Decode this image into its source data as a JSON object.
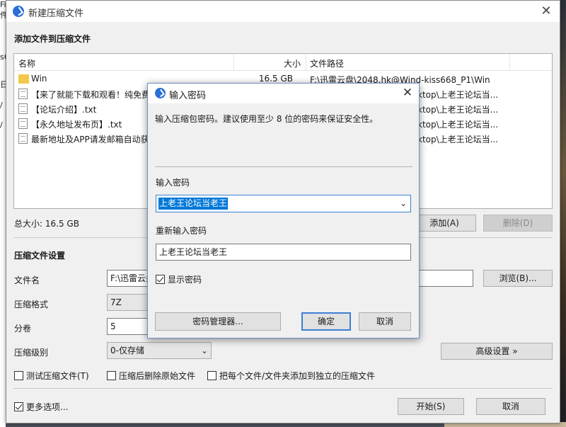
{
  "background": {
    "left_fragments": [
      "件",
      "Fi",
      "s6",
      "日",
      "/",
      "/"
    ]
  },
  "main_window": {
    "title": "新建压缩文件",
    "section_add": "添加文件到压缩文件",
    "columns": {
      "name": "名称",
      "size": "大小",
      "path": "文件路径"
    },
    "files": [
      {
        "name": "Win",
        "size": "16.5 GB",
        "path": "F:\\迅雷云盘\\2048.hk@Wind-kiss668_P1\\Win",
        "icon": "folder-icon"
      },
      {
        "name": "【来了就能下载和观看！纯免费",
        "size": "",
        "path": "ktop\\上老王论坛当...",
        "icon": "file-icon"
      },
      {
        "name": "【论坛介绍】.txt",
        "size": "",
        "path": "ktop\\上老王论坛当...",
        "icon": "file-icon"
      },
      {
        "name": "【永久地址发布页】.txt",
        "size": "",
        "path": "ktop\\上老王论坛当...",
        "icon": "file-icon"
      },
      {
        "name": "最新地址及APP请发邮箱自动获",
        "size": "",
        "path": "ktop\\上老王论坛当...",
        "icon": "file-icon"
      }
    ],
    "total_size": "总大小: 16.5 GB",
    "add_button": "添加(A)",
    "delete_button": "删除(D)",
    "section_settings": "压缩文件设置",
    "filename_label": "文件名",
    "filename_value": "F:\\迅雷云盘",
    "browse_button": "浏览(B)...",
    "format_label": "压缩格式",
    "format_value": "7Z",
    "split_label": "分卷",
    "split_value": "5",
    "level_label": "压缩级别",
    "level_value": "0-仅存储",
    "advanced_button": "高级设置 »",
    "test_archive": "测试压缩文件(T)",
    "delete_after": "压缩后删除原始文件",
    "separate_archives": "把每个文件/文件夹添加到独立的压缩文件",
    "more_options": "更多选项...",
    "start_button": "开始(S)",
    "cancel_button": "取消"
  },
  "password_dialog": {
    "title": "输入密码",
    "description": "输入压缩包密码。建议使用至少 8 位的密码来保证安全性。",
    "password_label": "输入密码",
    "password_value": "上老王论坛当老王",
    "confirm_label": "重新输入密码",
    "confirm_value": "上老王论坛当老王",
    "show_password": "显示密码",
    "show_password_checked": true,
    "manager_button": "密码管理器...",
    "ok_button": "确定",
    "cancel_button": "取消"
  }
}
